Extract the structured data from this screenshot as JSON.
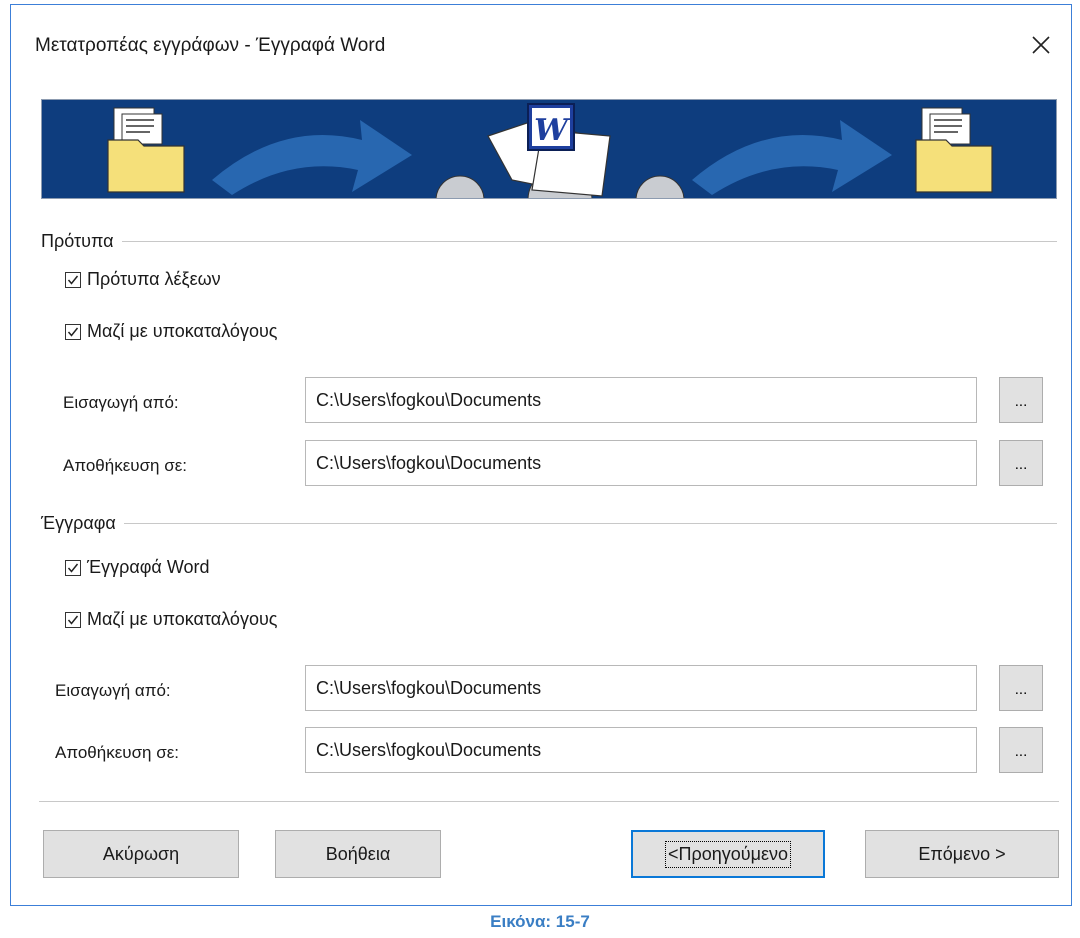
{
  "dialog": {
    "title": "Μετατροπέας εγγράφων - Έγγραφά Word"
  },
  "templates": {
    "section_title": "Πρότυπα",
    "checkbox1_label": "Πρότυπα λέξεων",
    "checkbox2_label": "Μαζί με υποκαταλόγους",
    "import_label": "Εισαγωγή από:",
    "import_value": "C:\\Users\\fogkou\\Documents",
    "save_label": "Αποθήκευση σε:",
    "save_value": "C:\\Users\\fogkou\\Documents",
    "browse_label": "..."
  },
  "documents": {
    "section_title": "Έγγραφα",
    "checkbox1_label": "Έγγραφά Word",
    "checkbox2_label": "Μαζί με υποκαταλόγους",
    "import_label": "Εισαγωγή από:",
    "import_value": "C:\\Users\\fogkou\\Documents",
    "save_label": "Αποθήκευση σε:",
    "save_value": "C:\\Users\\fogkou\\Documents",
    "browse_label": "..."
  },
  "buttons": {
    "cancel": "Ακύρωση",
    "help": "Βοήθεια",
    "previous": "<Προηγούμενο",
    "next": "Επόμενο >"
  },
  "caption": "Εικόνα: 15-7",
  "colors": {
    "banner": "#0e3d7e",
    "accent": "#0a78d7",
    "caption": "#3a7ec4"
  }
}
